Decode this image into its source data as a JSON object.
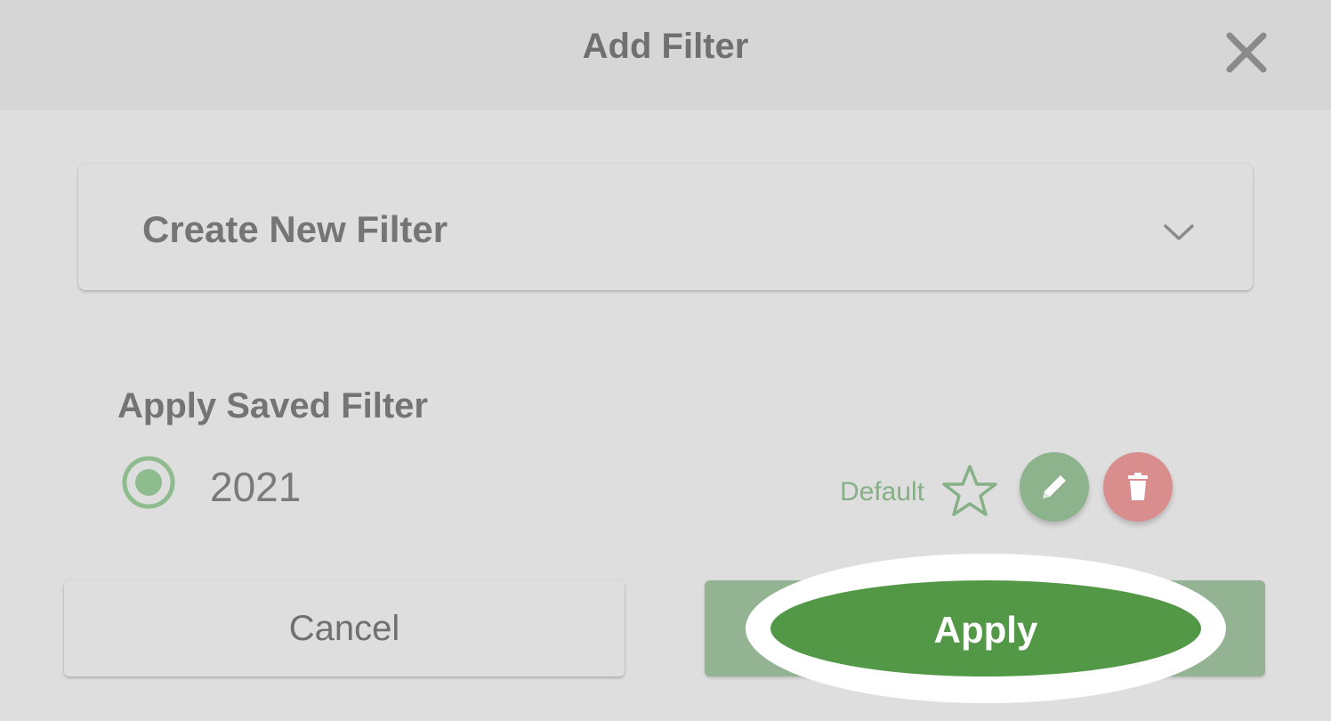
{
  "dialog": {
    "title": "Add Filter",
    "close_icon": "close-icon"
  },
  "filter_select": {
    "value": "Create New Filter",
    "icon": "chevron-down-icon"
  },
  "saved_filters": {
    "title": "Apply Saved Filter",
    "items": [
      {
        "name": "2021",
        "selected": true,
        "default_label": "Default",
        "icons": [
          "star-outline-icon",
          "pencil-icon",
          "trash-icon"
        ]
      }
    ]
  },
  "actions": {
    "cancel_label": "Cancel",
    "apply_label": "Apply"
  },
  "colors": {
    "accent_green": "#529846",
    "muted_green": "#93b393",
    "delete_red": "#d98d8d",
    "header_bg": "#d6d6d6",
    "body_bg": "#dedede"
  }
}
